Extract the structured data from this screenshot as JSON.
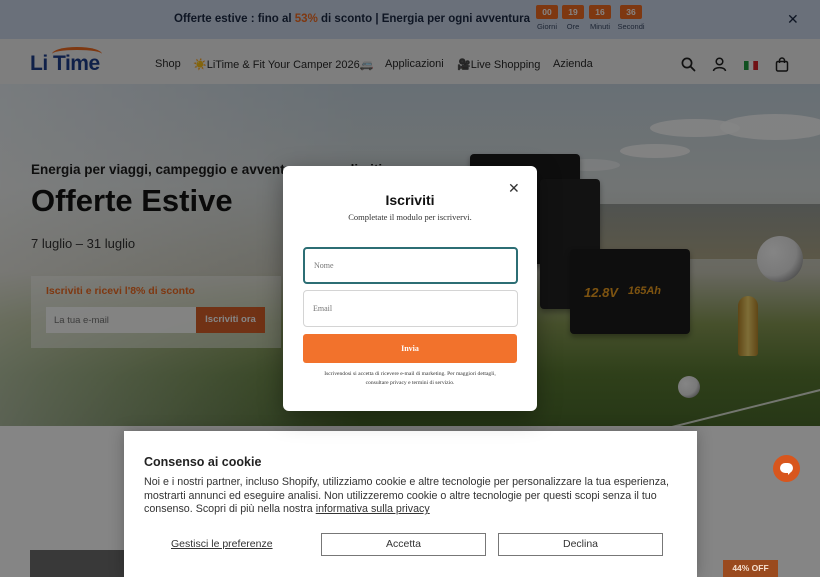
{
  "announcement": {
    "text_before": "Offerte estive : fino al ",
    "percent": "53%",
    "text_after": " di sconto | Energia per ogni avventura",
    "countdown": [
      {
        "value": "00",
        "label": "Giorni"
      },
      {
        "value": "19",
        "label": "Ore"
      },
      {
        "value": "16",
        "label": "Minuti"
      },
      {
        "value": "36",
        "label": "Secondi"
      }
    ],
    "close_icon": "close-icon",
    "colors": {
      "accent": "#f26b21",
      "background": "#cbd7ea"
    }
  },
  "header": {
    "logo_text": "Li Time",
    "nav": [
      {
        "label": "Shop"
      },
      {
        "label": "☀️LiTime & Fit Your Camper 2026🚐"
      },
      {
        "label": "Applicazioni"
      },
      {
        "label": "🎥Live Shopping"
      },
      {
        "label": "Azienda"
      }
    ],
    "icons": [
      "search-icon",
      "user-icon",
      "italy-flag-icon",
      "cart-icon"
    ]
  },
  "hero": {
    "subtitle": "Energia per viaggi, campeggio e avventure senza limiti",
    "title": "Offerte Estive",
    "dates": "7 luglio – 31 luglio",
    "signup": {
      "title": "Iscriviti e ricevi l'8% di sconto",
      "email_placeholder": "La tua e-mail",
      "button_label": "Iscriviti ora"
    },
    "battery_label_1": "12.8V",
    "battery_label_2": "165Ah"
  },
  "modal": {
    "title": "Iscriviti",
    "subtitle": "Completate il modulo per iscrivervi.",
    "name_placeholder": "Nome",
    "email_placeholder": "Email",
    "submit_label": "Invia",
    "fine_print": "Iscrivendosi si accetta di ricevere e-mail di marketing. Per maggiori dettagli, consultare privacy e termini di servizio."
  },
  "cookie": {
    "title": "Consenso ai cookie",
    "body": "Noi e i nostri partner, incluso Shopify, utilizziamo cookie e altre tecnologie per personalizzare la tua esperienza, mostrarti annunci ed eseguire analisi. Non utilizzeremo cookie o altre tecnologie per questi scopi senza il tuo consenso. Scopri di più nella nostra ",
    "privacy_link": "informativa sulla privacy",
    "manage_label": "Gestisci le preferenze",
    "accept_label": "Accetta",
    "decline_label": "Declina"
  },
  "badge": {
    "label": "44% OFF"
  },
  "chat_icon": "chat-icon"
}
